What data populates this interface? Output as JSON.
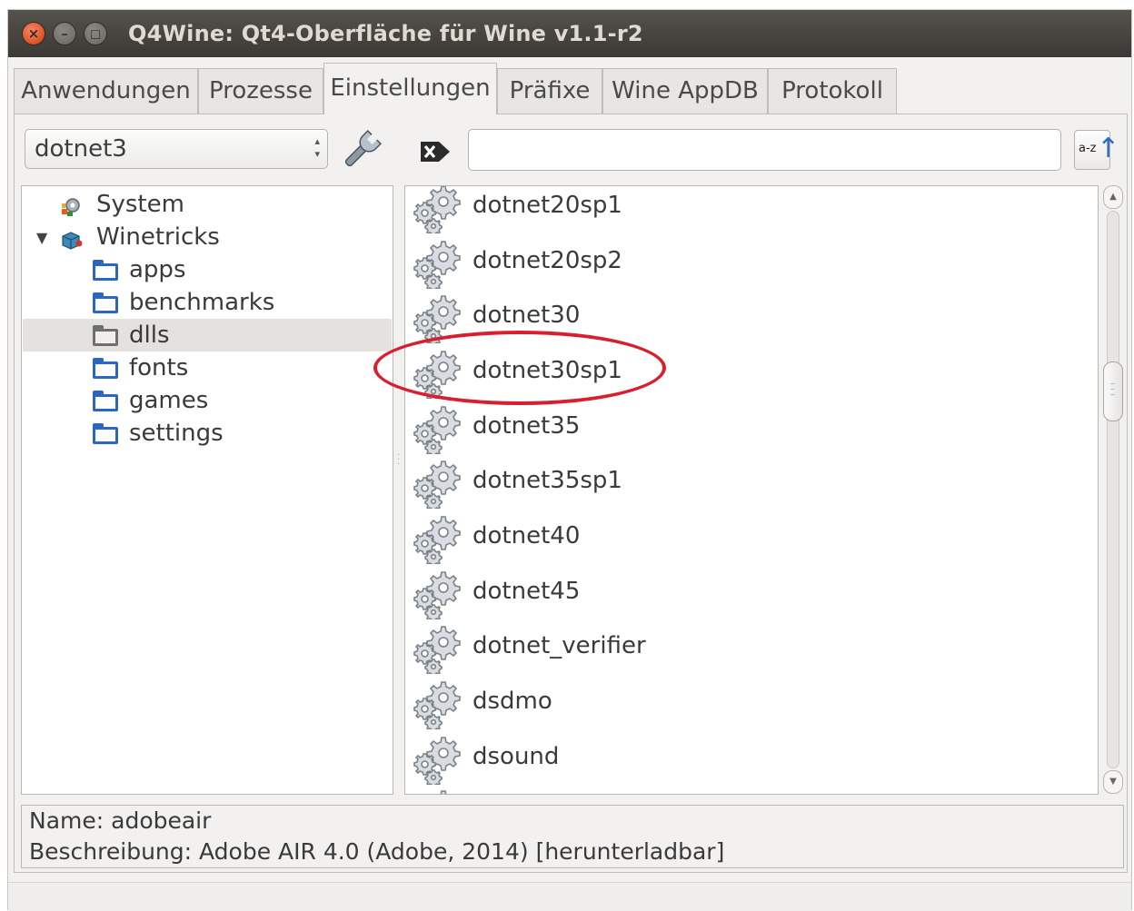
{
  "window": {
    "title": "Q4Wine: Qt4-Oberfläche für Wine v1.1-r2",
    "btn_close": "×",
    "btn_min": "–",
    "btn_max": "◻"
  },
  "tabs": [
    {
      "label": "Anwendungen"
    },
    {
      "label": "Prozesse"
    },
    {
      "label": "Einstellungen"
    },
    {
      "label": "Präfixe"
    },
    {
      "label": "Wine AppDB"
    },
    {
      "label": "Protokoll"
    }
  ],
  "active_tab": "Einstellungen",
  "toolbar": {
    "combo_value": "dotnet3",
    "search_value": "",
    "sort_label": "a-z"
  },
  "tree": {
    "items": [
      {
        "label": "System"
      },
      {
        "label": "Winetricks"
      },
      {
        "label": "apps"
      },
      {
        "label": "benchmarks"
      },
      {
        "label": "dlls"
      },
      {
        "label": "fonts"
      },
      {
        "label": "games"
      },
      {
        "label": "settings"
      }
    ],
    "selected": "dlls"
  },
  "list": {
    "items": [
      {
        "label": "dotnet20sp1"
      },
      {
        "label": "dotnet20sp2"
      },
      {
        "label": "dotnet30"
      },
      {
        "label": "dotnet30sp1"
      },
      {
        "label": "dotnet35"
      },
      {
        "label": "dotnet35sp1"
      },
      {
        "label": "dotnet40"
      },
      {
        "label": "dotnet45"
      },
      {
        "label": "dotnet_verifier"
      },
      {
        "label": "dsdmo"
      },
      {
        "label": "dsound"
      }
    ],
    "highlighted": "dotnet30sp1"
  },
  "info": {
    "name_line": "Name: adobeair",
    "desc_line": "Beschreibung: Adobe AIR 4.0 (Adobe, 2014) [herunterladbar]"
  },
  "colors": {
    "highlight_ring": "#d71f2f",
    "folder_blue": "#2a67bd"
  }
}
